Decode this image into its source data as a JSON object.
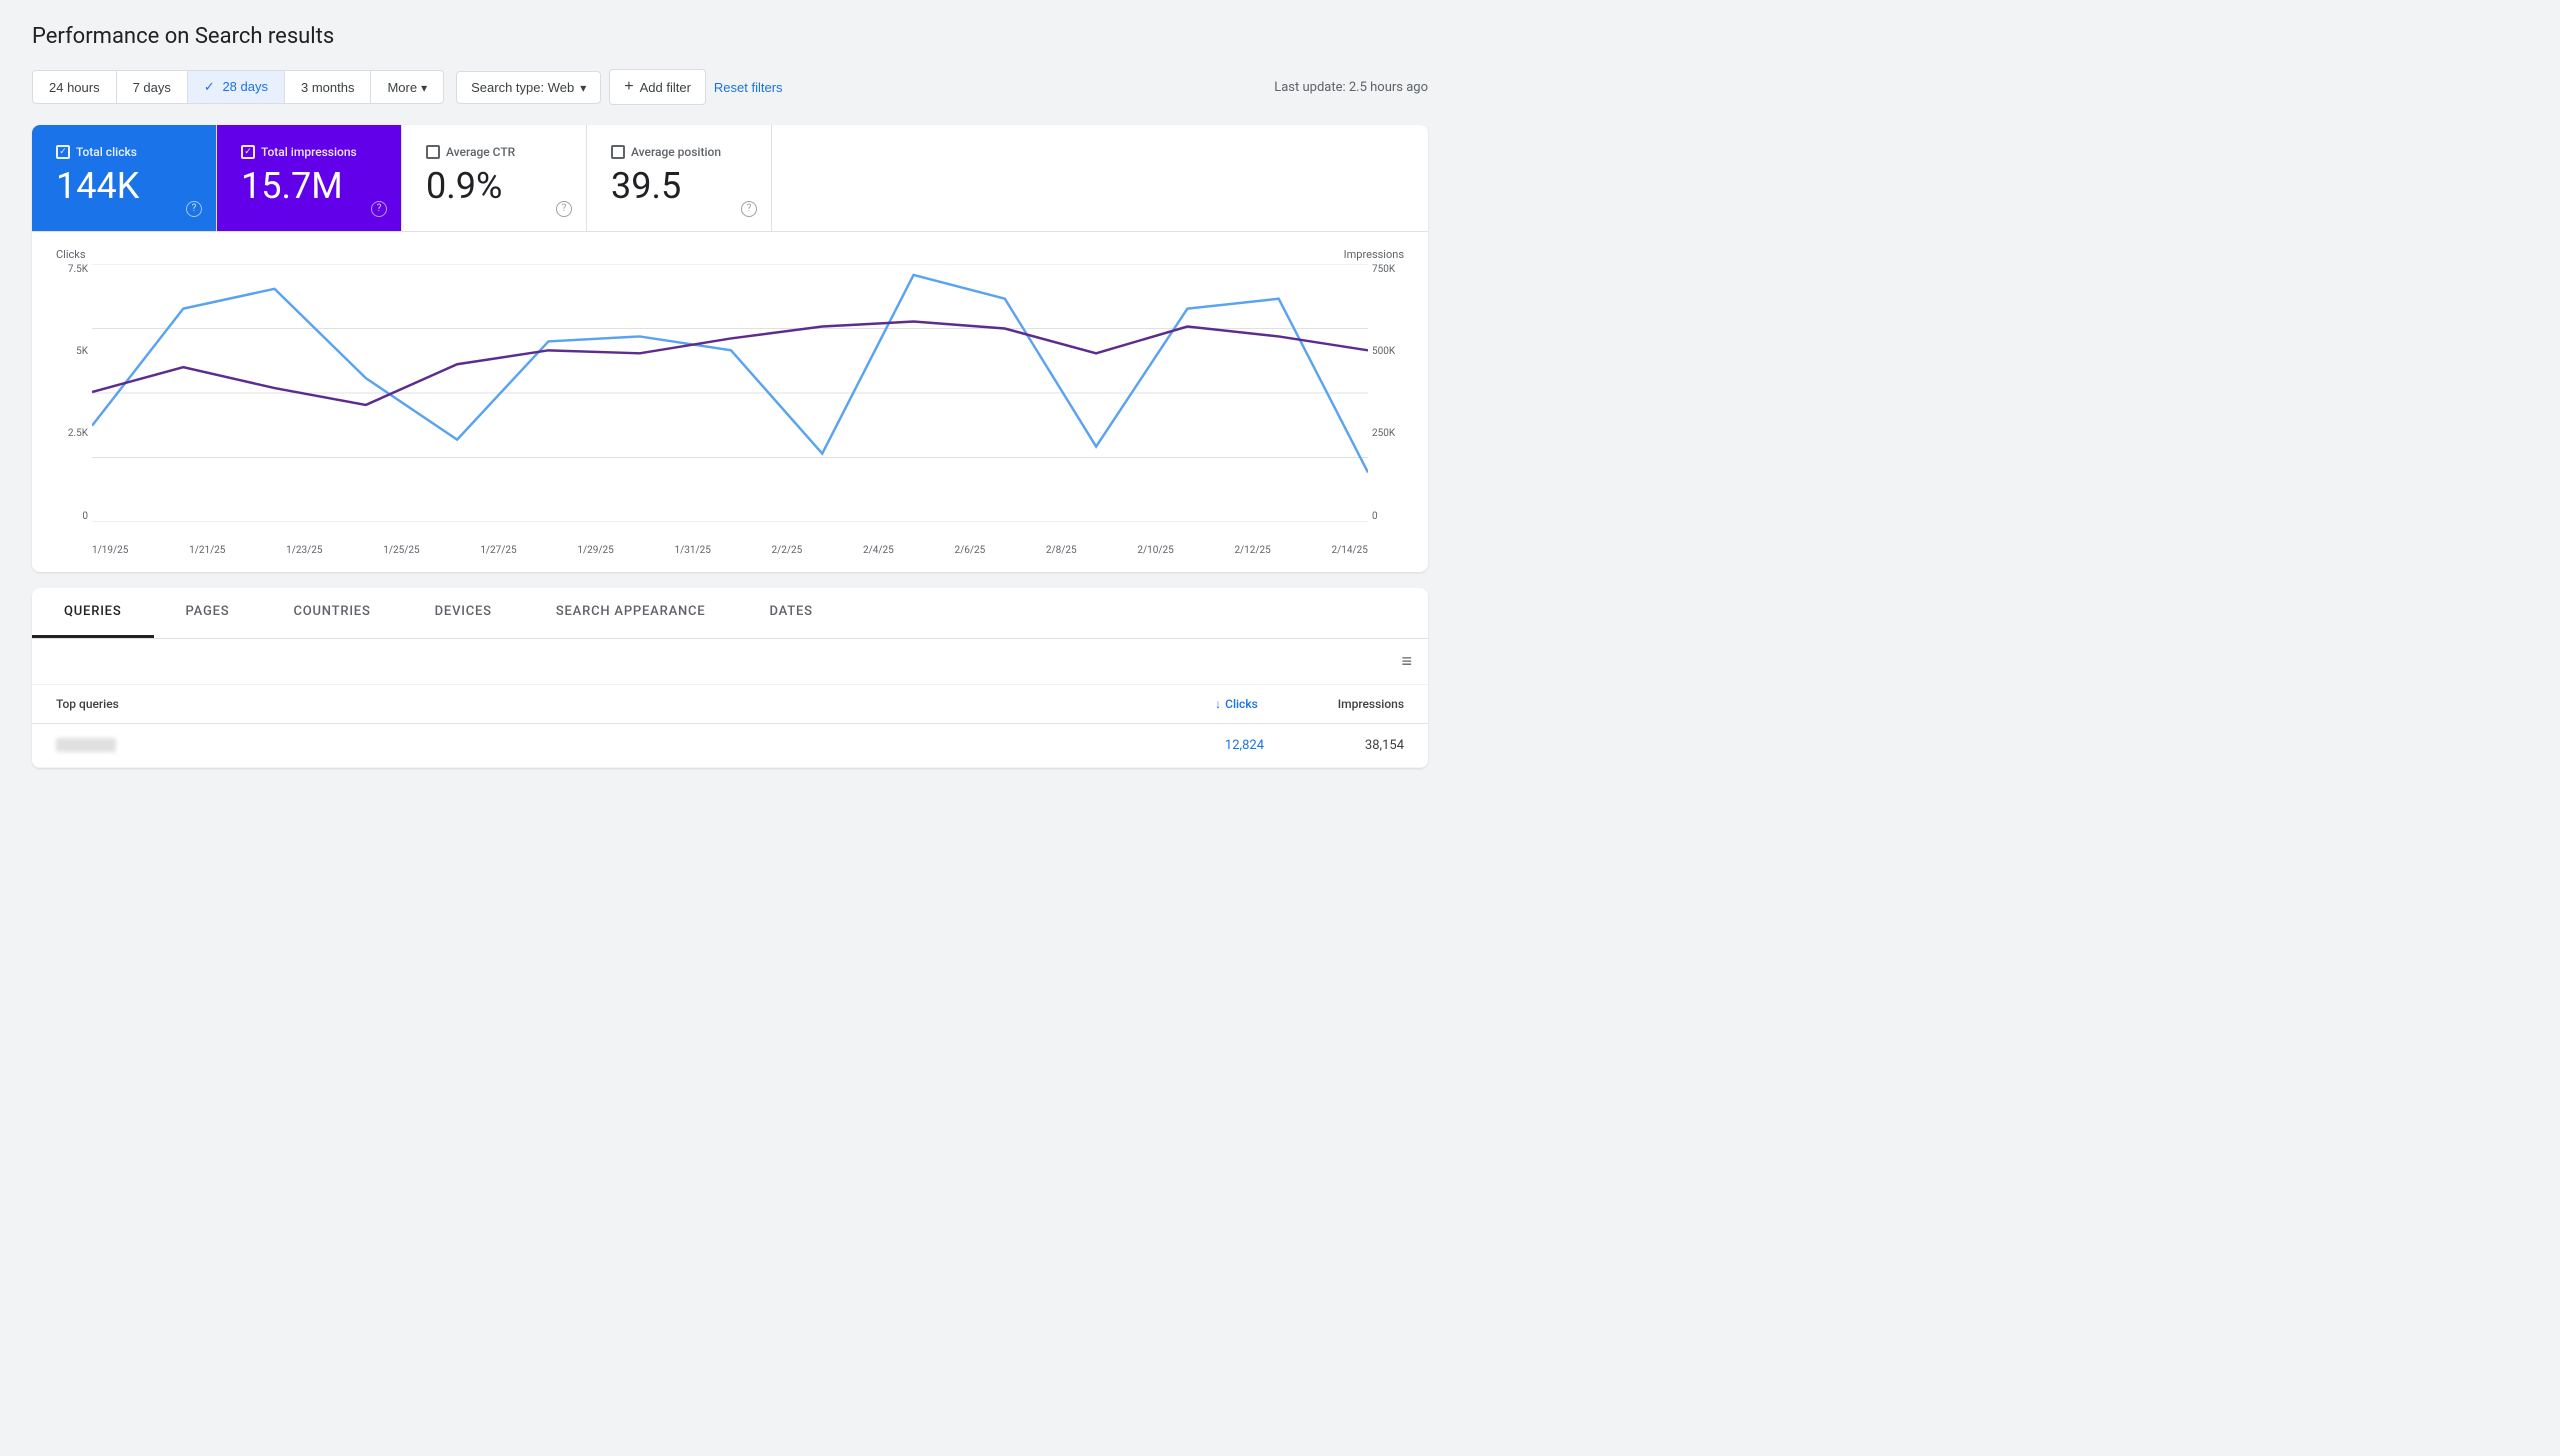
{
  "page": {
    "title": "Performance on Search results"
  },
  "toolbar": {
    "time_filters": [
      {
        "id": "24h",
        "label": "24 hours",
        "active": false
      },
      {
        "id": "7d",
        "label": "7 days",
        "active": false
      },
      {
        "id": "28d",
        "label": "28 days",
        "active": true
      },
      {
        "id": "3m",
        "label": "3 months",
        "active": false
      },
      {
        "id": "more",
        "label": "More",
        "active": false,
        "has_arrow": true
      }
    ],
    "search_type": "Search type: Web",
    "add_filter": "Add filter",
    "reset_filters": "Reset filters",
    "last_update": "Last update: 2.5 hours ago"
  },
  "metrics": [
    {
      "id": "clicks",
      "label": "Total clicks",
      "value": "144K",
      "active": true,
      "style": "active-blue"
    },
    {
      "id": "impressions",
      "label": "Total impressions",
      "value": "15.7M",
      "active": true,
      "style": "active-purple"
    },
    {
      "id": "ctr",
      "label": "Average CTR",
      "value": "0.9%",
      "active": false,
      "style": ""
    },
    {
      "id": "position",
      "label": "Average position",
      "value": "39.5",
      "active": false,
      "style": ""
    }
  ],
  "chart": {
    "y_left_label": "Clicks",
    "y_right_label": "Impressions",
    "y_left_ticks": [
      "7.5K",
      "5K",
      "2.5K",
      "0"
    ],
    "y_right_ticks": [
      "750K",
      "500K",
      "250K",
      "0"
    ],
    "x_labels": [
      "1/19/25",
      "1/21/25",
      "1/23/25",
      "1/25/25",
      "1/27/25",
      "1/29/25",
      "1/31/25",
      "2/2/25",
      "2/4/25",
      "2/6/25",
      "2/8/25",
      "2/10/25",
      "2/12/25",
      "2/14/25"
    ]
  },
  "tabs": [
    {
      "id": "queries",
      "label": "QUERIES",
      "active": true
    },
    {
      "id": "pages",
      "label": "PAGES",
      "active": false
    },
    {
      "id": "countries",
      "label": "COUNTRIES",
      "active": false
    },
    {
      "id": "devices",
      "label": "DEVICES",
      "active": false
    },
    {
      "id": "search_appearance",
      "label": "SEARCH APPEARANCE",
      "active": false
    },
    {
      "id": "dates",
      "label": "DATES",
      "active": false
    }
  ],
  "table": {
    "header_queries": "Top queries",
    "header_clicks": "Clicks",
    "header_impressions": "Impressions",
    "rows": [
      {
        "query": "[blurred]",
        "clicks": "12,824",
        "impressions": "38,154"
      }
    ]
  },
  "colors": {
    "blue_line": "#4d90fe",
    "purple_line": "#5b2d8e",
    "blue_active": "#1a73e8",
    "purple_active": "#6200ea"
  }
}
